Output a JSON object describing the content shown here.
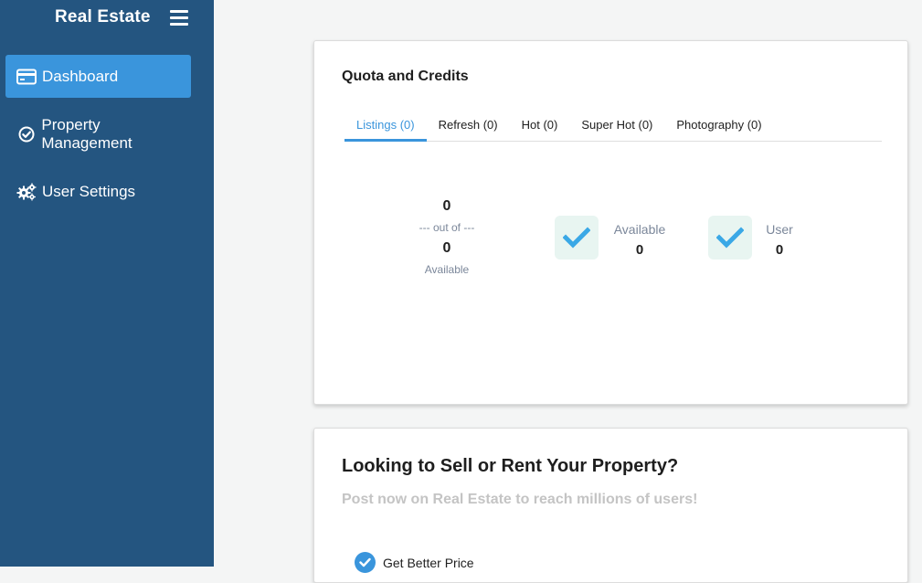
{
  "sidebar": {
    "brand": "Real Estate",
    "items": [
      {
        "label": "Dashboard",
        "icon": "credit-card-icon",
        "active": true
      },
      {
        "label": "Property Management",
        "icon": "check-circle-icon",
        "active": false
      },
      {
        "label": "User Settings",
        "icon": "gears-icon",
        "active": false
      }
    ]
  },
  "quota": {
    "title": "Quota and Credits",
    "tabs": [
      {
        "label": "Listings (0)",
        "active": true
      },
      {
        "label": "Refresh (0)",
        "active": false
      },
      {
        "label": "Hot (0)",
        "active": false
      },
      {
        "label": "Super Hot (0)",
        "active": false
      },
      {
        "label": "Photography (0)",
        "active": false
      }
    ],
    "used": "0",
    "out_of_text": "--- out of ---",
    "total": "0",
    "total_label": "Available",
    "available": {
      "label": "Available",
      "value": "0"
    },
    "user": {
      "label": "User",
      "value": "0"
    }
  },
  "promo": {
    "title": "Looking to Sell or Rent Your Property?",
    "subtitle": "Post now on Real Estate to reach millions of users!",
    "benefits": [
      "Get Better Price"
    ]
  },
  "colors": {
    "sidebar_bg": "#245580",
    "accent": "#3a95dc",
    "check_bg": "#e8f5f1",
    "muted_text": "#7b879a"
  }
}
